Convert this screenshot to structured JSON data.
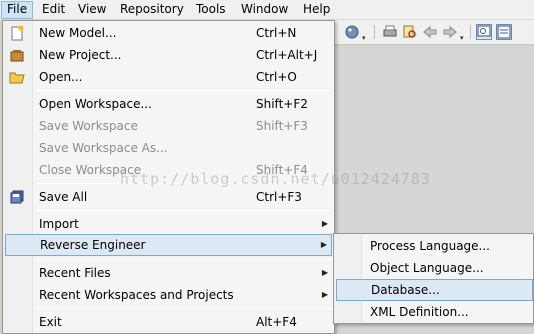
{
  "menubar": {
    "items": [
      "File",
      "Edit",
      "View",
      "Repository",
      "Tools",
      "Window",
      "Help"
    ]
  },
  "file_menu": {
    "new_model": {
      "label": "New Model...",
      "shortcut": "Ctrl+N",
      "icon": "new-model-icon"
    },
    "new_project": {
      "label": "New Project...",
      "shortcut": "Ctrl+Alt+J",
      "icon": "new-project-icon"
    },
    "open": {
      "label": "Open...",
      "shortcut": "Ctrl+O",
      "icon": "open-folder-icon"
    },
    "open_workspace": {
      "label": "Open Workspace...",
      "shortcut": "Shift+F2"
    },
    "save_workspace": {
      "label": "Save Workspace",
      "shortcut": "Shift+F3"
    },
    "save_workspace_as": {
      "label": "Save Workspace As..."
    },
    "close_workspace": {
      "label": "Close Workspace",
      "shortcut": "Shift+F4"
    },
    "save_all": {
      "label": "Save All",
      "shortcut": "Ctrl+F3",
      "icon": "save-all-icon"
    },
    "import": {
      "label": "Import"
    },
    "reverse_engineer": {
      "label": "Reverse Engineer"
    },
    "recent_files": {
      "label": "Recent Files"
    },
    "recent_workspaces": {
      "label": "Recent Workspaces and Projects"
    },
    "exit": {
      "label": "Exit",
      "shortcut": "Alt+F4"
    }
  },
  "reverse_engineer_submenu": {
    "items": [
      "Process Language...",
      "Object Language...",
      "Database...",
      "XML Definition..."
    ],
    "highlighted": "Database..."
  },
  "watermark": "http://blog.csdn.net/u012424783",
  "colors": {
    "menu_bg": "#f5f5f5",
    "highlight_bg": "#dce9f5",
    "highlight_border": "#7fa9d3",
    "disabled_text": "#8d8d8d"
  }
}
